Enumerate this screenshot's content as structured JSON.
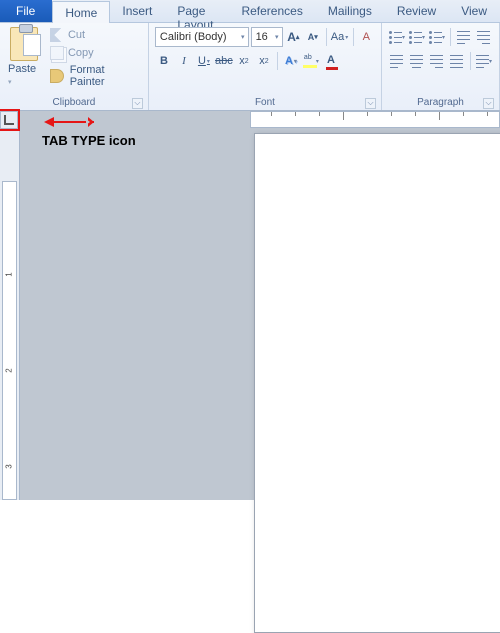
{
  "tabs": {
    "file": "File",
    "home": "Home",
    "insert": "Insert",
    "page_layout": "Page Layout",
    "references": "References",
    "mailings": "Mailings",
    "review": "Review",
    "view": "View"
  },
  "clipboard": {
    "paste": "Paste",
    "cut": "Cut",
    "copy": "Copy",
    "format_painter": "Format Painter",
    "label": "Clipboard"
  },
  "font": {
    "name": "Calibri (Body)",
    "size": "16",
    "label": "Font"
  },
  "paragraph": {
    "label": "Paragraph"
  },
  "vruler_numbers": [
    "1",
    "2",
    "3"
  ],
  "annotation": "TAB TYPE icon"
}
